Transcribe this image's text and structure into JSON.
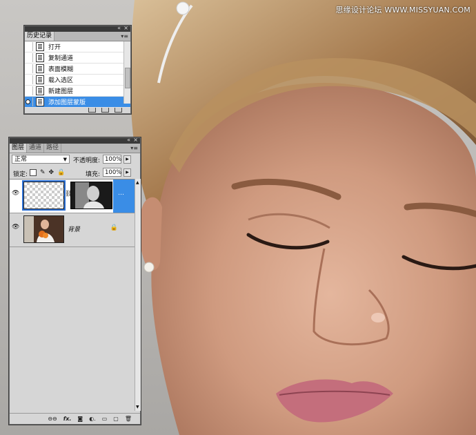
{
  "watermark": "思缘设计论坛 WWW.MISSYUAN.COM",
  "history_panel": {
    "tab": "历史记录",
    "items": [
      {
        "label": "打开",
        "selected": false
      },
      {
        "label": "复制通道",
        "selected": false
      },
      {
        "label": "表面模糊",
        "selected": false
      },
      {
        "label": "载入选区",
        "selected": false
      },
      {
        "label": "新建图层",
        "selected": false
      },
      {
        "label": "添加图层蒙版",
        "selected": true
      }
    ]
  },
  "layers_panel": {
    "tabs": [
      "图层",
      "通道",
      "路径"
    ],
    "blend_mode": "正常",
    "opacity_label": "不透明度:",
    "opacity_value": "100%",
    "lock_label": "锁定:",
    "fill_label": "填充:",
    "fill_value": "100%",
    "layers": [
      {
        "name": "",
        "selected": true,
        "has_mask": true
      },
      {
        "name": "背景",
        "selected": false,
        "locked": true
      }
    ]
  },
  "colors": {
    "selection": "#3a8de6",
    "panel_bg": "#d6d6d6",
    "panel_dark": "#3a3a3a"
  }
}
